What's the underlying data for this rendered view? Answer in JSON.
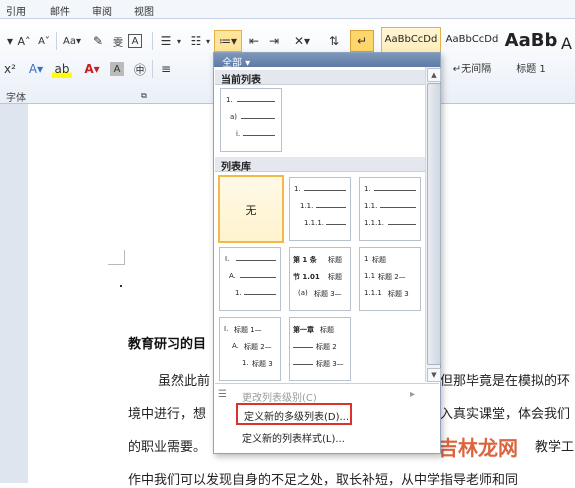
{
  "ribbon_tabs": [
    "引用",
    "邮件",
    "审阅",
    "视图"
  ],
  "ribbon": {
    "font_group_label": "字体",
    "styles": [
      {
        "preview": "AaBbCcDd",
        "name": ""
      },
      {
        "preview": "AaBbCcDd",
        "name": "↵无间隔"
      },
      {
        "preview": "AaBb",
        "name": "标题 1"
      },
      {
        "preview": "A",
        "name": ""
      }
    ]
  },
  "dropdown": {
    "filter_label": "全部 ▾",
    "current_list_header": "当前列表",
    "library_header": "列表库",
    "none_label": "无",
    "menu_items": {
      "change_level": "更改列表级别(C)",
      "define_multilevel": "定义新的多级列表(D)...",
      "define_style": "定义新的列表样式(L)..."
    }
  },
  "thumbnails": {
    "current": {
      "l1": "1.",
      "l2": "a)",
      "l3": "i."
    },
    "lib1": {
      "l1": "1.",
      "l2": "1.1.",
      "l3": "1.1.1."
    },
    "lib2": {
      "l1": "1.",
      "l2": "1.1.",
      "l3": "1.1.1."
    },
    "lib3": {
      "l1": "I.",
      "l2": "A.",
      "l3": "1."
    },
    "lib4": {
      "l1": "第 1 条",
      "l1b": "标题",
      "l2": "节 1.01",
      "l2b": "标题",
      "l3": "(a)",
      "l3b": "标题 3—"
    },
    "lib5": {
      "l1": "1",
      "l1b": "标题",
      "l2": "1.1",
      "l2b": "标题 2—",
      "l3": "1.1.1",
      "l3b": "标题 3"
    },
    "lib6": {
      "l1": "I.",
      "l1b": "标题 1—",
      "l2": "A.",
      "l2b": "标题 2—",
      "l3": "1.",
      "l3b": "标题 3"
    },
    "lib7": {
      "l1": "第一章",
      "l1b": "标题",
      "l2": "",
      "l2b": "标题 2",
      "l3": "",
      "l3b": "标题 3—"
    }
  },
  "document": {
    "heading": "教育研习的目",
    "line1_left": "虽然此前",
    "line1_right": "但那毕竟是在模拟的环",
    "line2_left": "境中进行，想",
    "line2_right": "入真实课堂，体会我们",
    "line3_left": "的职业需要。",
    "line3_right": "教学工",
    "line4": "作中我们可以发现自身的不足之处，取长补短，从中学指导老师和同"
  },
  "watermark": "吉林龙网",
  "colors": {
    "accent": "#f0b94a",
    "highlight_box": "#d9342b",
    "header": "#5e7aa5"
  }
}
